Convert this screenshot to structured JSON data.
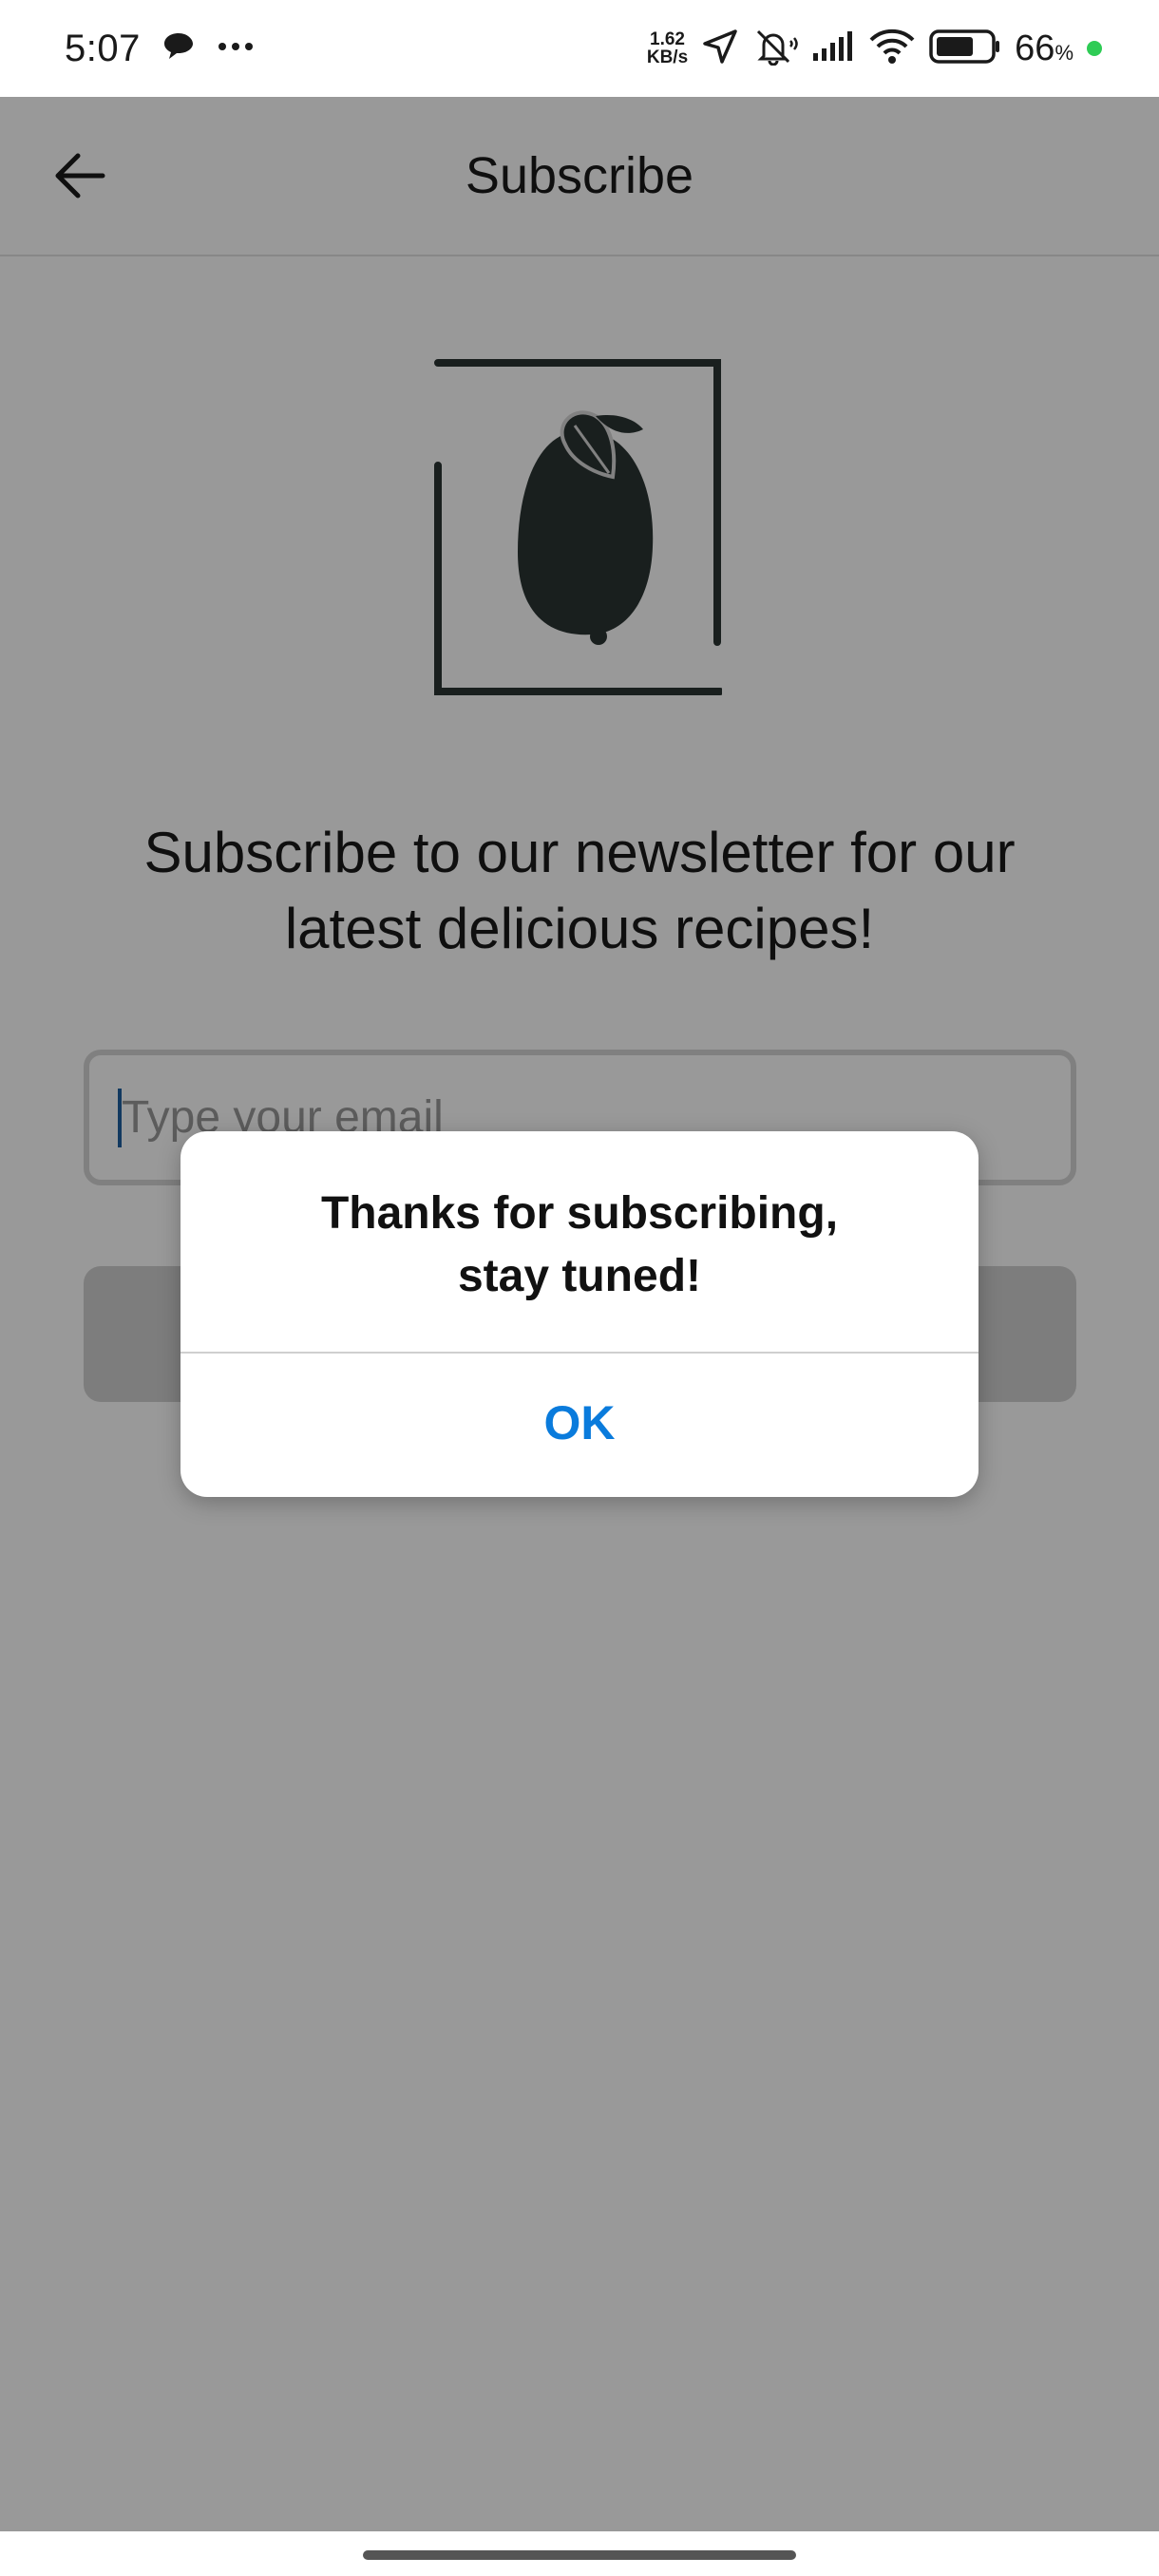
{
  "status_bar": {
    "time": "5:07",
    "net_speed_value": "1.62",
    "net_speed_unit": "KB/s",
    "battery_percent": "66",
    "battery_percent_sign": "%",
    "icons": [
      "chat-bubble-icon",
      "more-dots-icon",
      "location-arrow-icon",
      "bell-muted-icon",
      "signal-icon",
      "wifi-icon",
      "battery-icon"
    ]
  },
  "app_bar": {
    "title": "Subscribe",
    "back_icon": "arrow-left-icon"
  },
  "main": {
    "logo_icon": "lemon-frame-logo",
    "headline": "Subscribe to our newsletter for our latest delicious recipes!",
    "email_placeholder": "Type your email"
  },
  "dialog": {
    "message": "Thanks for subscribing,\nstay tuned!",
    "ok_label": "OK"
  },
  "colors": {
    "accent": "#0a7bdc",
    "logo": "#2b3533",
    "scrim": "rgba(0,0,0,0.4)"
  }
}
